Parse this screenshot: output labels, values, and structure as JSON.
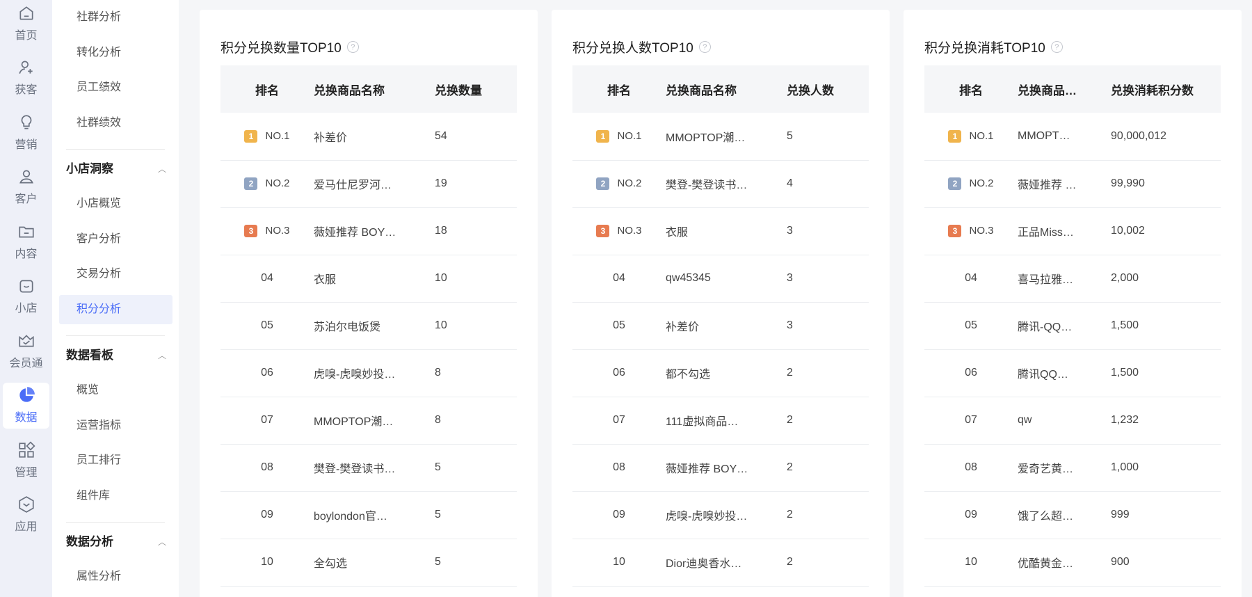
{
  "rail": [
    {
      "label": "首页",
      "icon": "home-icon"
    },
    {
      "label": "获客",
      "icon": "user-add-icon"
    },
    {
      "label": "营销",
      "icon": "bulb-icon"
    },
    {
      "label": "客户",
      "icon": "user-icon"
    },
    {
      "label": "内容",
      "icon": "folder-icon"
    },
    {
      "label": "小店",
      "icon": "shop-icon"
    },
    {
      "label": "会员通",
      "icon": "crown-icon"
    },
    {
      "label": "数据",
      "icon": "pie-chart-icon"
    },
    {
      "label": "管理",
      "icon": "grid-icon"
    },
    {
      "label": "应用",
      "icon": "cube-icon"
    }
  ],
  "subnav": {
    "top_items": [
      "社群分析",
      "转化分析",
      "员工绩效",
      "社群绩效"
    ],
    "groups": [
      {
        "title": "小店洞察",
        "items": [
          "小店概览",
          "客户分析",
          "交易分析",
          "积分分析"
        ]
      },
      {
        "title": "数据看板",
        "items": [
          "概览",
          "运营指标",
          "员工排行",
          "组件库"
        ]
      },
      {
        "title": "数据分析",
        "items": [
          "属性分析"
        ]
      }
    ],
    "active": "积分分析"
  },
  "cards": [
    {
      "title": "积分兑换数量TOP10",
      "headers": [
        "排名",
        "兑换商品名称",
        "兑换数量"
      ],
      "rows": [
        [
          "NO.1",
          "补差价",
          "54"
        ],
        [
          "NO.2",
          "爱马仕尼罗河…",
          "19"
        ],
        [
          "NO.3",
          "薇娅推荐 BOY…",
          "18"
        ],
        [
          "04",
          "衣服",
          "10"
        ],
        [
          "05",
          "苏泊尔电饭煲",
          "10"
        ],
        [
          "06",
          "虎嗅-虎嗅妙投…",
          "8"
        ],
        [
          "07",
          "MMOPTOP潮…",
          "8"
        ],
        [
          "08",
          "樊登-樊登读书…",
          "5"
        ],
        [
          "09",
          "boylondon官…",
          "5"
        ],
        [
          "10",
          "全勾选",
          "5"
        ]
      ]
    },
    {
      "title": "积分兑换人数TOP10",
      "headers": [
        "排名",
        "兑换商品名称",
        "兑换人数"
      ],
      "rows": [
        [
          "NO.1",
          "MMOPTOP潮…",
          "5"
        ],
        [
          "NO.2",
          "樊登-樊登读书…",
          "4"
        ],
        [
          "NO.3",
          "衣服",
          "3"
        ],
        [
          "04",
          "qw45345",
          "3"
        ],
        [
          "05",
          "补差价",
          "3"
        ],
        [
          "06",
          "都不勾选",
          "2"
        ],
        [
          "07",
          "111虚拟商品…",
          "2"
        ],
        [
          "08",
          "薇娅推荐 BOY…",
          "2"
        ],
        [
          "09",
          "虎嗅-虎嗅妙投…",
          "2"
        ],
        [
          "10",
          "Dior迪奥香水…",
          "2"
        ]
      ]
    },
    {
      "title": "积分兑换消耗TOP10",
      "headers": [
        "排名",
        "兑换商品…",
        "兑换消耗积分数"
      ],
      "rows": [
        [
          "NO.1",
          "MMOPT…",
          "90,000,012"
        ],
        [
          "NO.2",
          "薇娅推荐 …",
          "99,990"
        ],
        [
          "NO.3",
          "正品Miss…",
          "10,002"
        ],
        [
          "04",
          "喜马拉雅…",
          "2,000"
        ],
        [
          "05",
          "腾讯-QQ…",
          "1,500"
        ],
        [
          "06",
          "腾讯QQ…",
          "1,500"
        ],
        [
          "07",
          "qw",
          "1,232"
        ],
        [
          "08",
          "爱奇艺黄…",
          "1,000"
        ],
        [
          "09",
          "饿了么超…",
          "999"
        ],
        [
          "10",
          "优酷黄金…",
          "900"
        ]
      ]
    }
  ],
  "badges": [
    "1",
    "2",
    "3"
  ],
  "help_glyph": "?"
}
